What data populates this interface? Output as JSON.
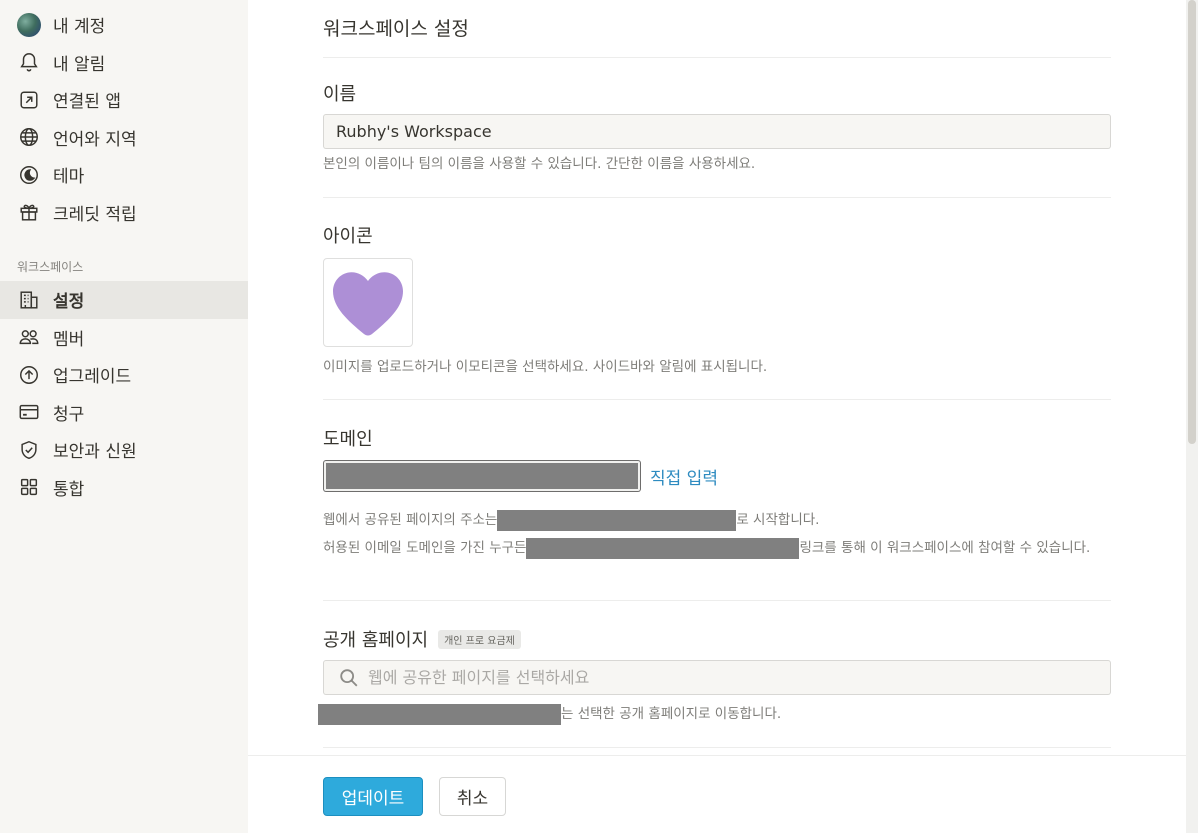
{
  "sidebar": {
    "account_items": [
      {
        "label": "내 계정",
        "icon": "avatar"
      },
      {
        "label": "내 알림",
        "icon": "bell-icon"
      },
      {
        "label": "연결된 앱",
        "icon": "external-link-icon"
      },
      {
        "label": "언어와 지역",
        "icon": "globe-icon"
      },
      {
        "label": "테마",
        "icon": "moon-icon"
      },
      {
        "label": "크레딧 적립",
        "icon": "gift-icon"
      }
    ],
    "workspace_heading": "워크스페이스",
    "workspace_items": [
      {
        "label": "설정",
        "icon": "building-icon",
        "active": true
      },
      {
        "label": "멤버",
        "icon": "members-icon"
      },
      {
        "label": "업그레이드",
        "icon": "upgrade-arrow-icon"
      },
      {
        "label": "청구",
        "icon": "credit-card-icon"
      },
      {
        "label": "보안과 신원",
        "icon": "shield-check-icon"
      },
      {
        "label": "통합",
        "icon": "grid-icon"
      }
    ]
  },
  "main": {
    "title": "워크스페이스 설정",
    "name_section": {
      "label": "이름",
      "value": "Rubhy's Workspace",
      "help": "본인의 이름이나 팀의 이름을 사용할 수 있습니다. 간단한 이름을 사용하세요."
    },
    "icon_section": {
      "label": "아이콘",
      "icon": "purple-heart-icon",
      "icon_color": "#ad8fd6",
      "help": "이미지를 업로드하거나 이모티콘을 선택하세요. 사이드바와 알림에 표시됩니다."
    },
    "domain_section": {
      "label": "도메인",
      "custom_link": "직접 입력",
      "help1_suffix": "로 시작합니다.",
      "help1_prefix": "웹에서 공유된 페이지의 주소는",
      "help2_prefix": "허용된 이메일 도메인을 가진 누구든",
      "help2_suffix": "링크를 통해 이 워크스페이스에 참여할 수 있습니다."
    },
    "homepage_section": {
      "label": "공개 홈페이지",
      "badge": "개인 프로 요금제",
      "search_placeholder": "웹에 공유한 페이지를 선택하세요",
      "help_suffix": "는 선택한 공개 홈페이지로 이동합니다."
    }
  },
  "footer": {
    "update_label": "업데이트",
    "cancel_label": "취소"
  },
  "colors": {
    "sidebar_bg": "#f7f6f3",
    "accent": "#2eaadc",
    "link": "#2e8bc0"
  }
}
